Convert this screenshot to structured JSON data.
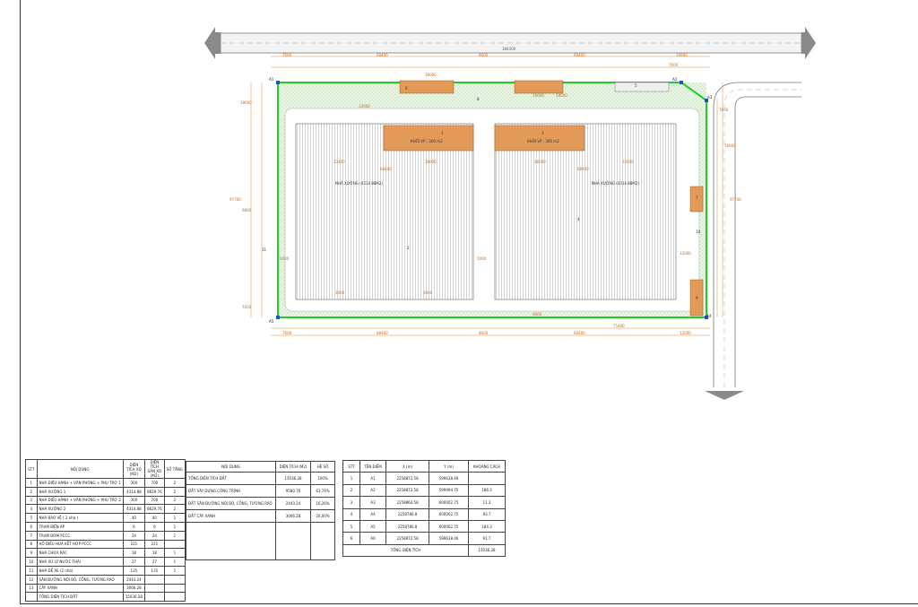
{
  "colors": {
    "boundary": "#22cc22",
    "building_office": "#e39a58",
    "greenery": "#cfe8c8",
    "dimension": "#e08a3a",
    "road": "#eeeeee",
    "corner_marker": "#1f4fd6"
  },
  "plan": {
    "top_dims": [
      "7600",
      "68400",
      "8600",
      "68400",
      "7600",
      "10800"
    ],
    "total_dim": "184300",
    "inner_dims": [
      "36000",
      "16000",
      "18000"
    ],
    "bottom_dims": [
      "7600",
      "68400",
      "8600",
      "68400",
      "12000"
    ],
    "bottom_inner_dim": "75400",
    "left_dims": [
      "18000",
      "97700",
      "9800",
      "7600"
    ],
    "right_dims": [
      "16000",
      "97700",
      "7600",
      "12000"
    ],
    "corners": [
      "A1",
      "A2",
      "A3",
      "A4",
      "A5",
      "A6"
    ],
    "office_labels": [
      "KHỐI VP : 300 m2",
      "KHỐI VP : 300 m2"
    ],
    "workshop_labels": [
      "NHÀ XƯỞNG (4314.88M2)",
      "NHÀ XƯỞNG (4314.88M2)"
    ],
    "workshop_dims": [
      "68400",
      "68400",
      "33400",
      "33400",
      "36000",
      "36000"
    ],
    "misc_dims": [
      "5000",
      "5000",
      "10000",
      "3000",
      "3600",
      "6600"
    ],
    "item_numbers": [
      "1",
      "2",
      "3",
      "4",
      "5",
      "6",
      "7",
      "8",
      "9",
      "10",
      "11"
    ]
  },
  "table_items": {
    "headers": [
      "STT",
      "NỘI DUNG",
      "DIỆN TÍCH XD (M2)",
      "DIỆN TÍCH SÀN XD (M2)",
      "SỐ TẦNG"
    ],
    "rows": [
      [
        "1",
        "NHÀ ĐIỀU HÀNH + VĂN PHÒNG + PHỤ TRỢ 1",
        "300",
        "700",
        "2"
      ],
      [
        "2",
        "NHÀ XƯỞNG 1",
        "4314.88",
        "8629.76",
        "2"
      ],
      [
        "3",
        "NHÀ ĐIỀU HÀNH + VĂN PHÒNG + PHỤ TRỢ 2",
        "300",
        "700",
        "2"
      ],
      [
        "4",
        "NHÀ XƯỞNG 2",
        "4314.88",
        "8629.76",
        "2"
      ],
      [
        "5",
        "NHÀ BẢO VỆ ( 2 nhà )",
        "40",
        "40",
        "1"
      ],
      [
        "6",
        "TRẠM BIẾN ÁP",
        "6",
        "6",
        "1"
      ],
      [
        "7",
        "TRẠM BƠM PCCC",
        "24",
        "24",
        "1"
      ],
      [
        "8",
        "HỒ ĐIỀU HOÀ KẾT HỢP PCCC",
        "221",
        "221",
        ""
      ],
      [
        "9",
        "NHÀ CHỨA RÁC",
        "18",
        "18",
        "1"
      ],
      [
        "10",
        "NHÀ XỬ LÝ NƯỚC THẢI",
        "27",
        "27",
        "1"
      ],
      [
        "11",
        "NHÀ ĐỂ XE (2 nhà)",
        "135",
        "135",
        "1"
      ],
      [
        "12",
        "SÂN ĐƯỜNG NỘI BỘ, CỔNG, TƯỜNG RÀO",
        "2443.24",
        "",
        ""
      ],
      [
        "13",
        "CÂY XANH",
        "3066.28",
        "",
        ""
      ],
      [
        "",
        "TỔNG DIỆN TÍCH ĐẤT",
        "15036.28",
        "",
        ""
      ]
    ]
  },
  "table_land": {
    "headers": [
      "NỘI DUNG",
      "DIỆN TÍCH (M2)",
      "HỆ SỐ"
    ],
    "rows": [
      [
        "TỔNG DIỆN TÍCH ĐẤT",
        "15036.28",
        "100%"
      ],
      [
        "ĐẤT XÂY DỰNG CÔNG TRÌNH",
        "9580.76",
        "63,74%"
      ],
      [
        "ĐẤT SÂN ĐƯỜNG NỘI BỘ, CỔNG, TƯỜNG RÀO",
        "2443.24",
        "16,26%"
      ],
      [
        "ĐẤT CÂY XANH",
        "3006.28",
        "20,00%"
      ]
    ]
  },
  "table_coords": {
    "headers": [
      "STT",
      "TÊN ĐIỂM",
      "X (m)",
      "Y (m)",
      "KHOẢNG CÁCH"
    ],
    "rows": [
      [
        "1",
        "A1",
        "2258872.58",
        "599638.46",
        ""
      ],
      [
        "2",
        "A2",
        "2258872.58",
        "599994.75",
        "186.3"
      ],
      [
        "3",
        "A3",
        "2258864.58",
        "600002.75",
        "11.3"
      ],
      [
        "4",
        "A4",
        "2258780.8",
        "600002.75",
        "83.7"
      ],
      [
        "5",
        "A5",
        "2258780.8",
        "600002.75",
        "184.3"
      ],
      [
        "6",
        "A6",
        "2258872.58",
        "599638.46",
        "91.7"
      ]
    ],
    "total_label": "TỔNG DIỆN TÍCH",
    "total_value": "15036.28"
  }
}
